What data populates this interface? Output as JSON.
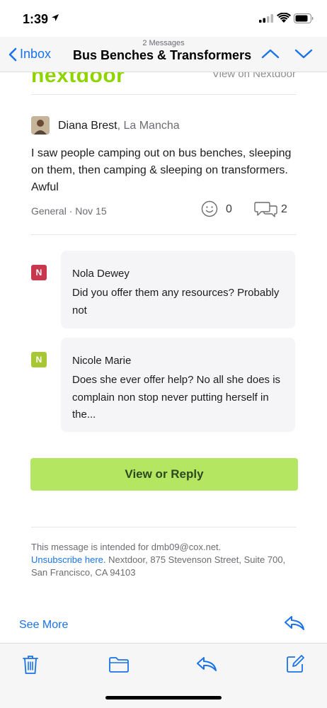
{
  "status_bar": {
    "time": "1:39"
  },
  "nav": {
    "message_count": "2 Messages",
    "back_label": "Inbox",
    "title": "Bus Benches & Transformers"
  },
  "email": {
    "logo_text": "nextdoor",
    "view_on_link": "View on Nextdoor",
    "post": {
      "author": "Diana Brest",
      "neighborhood": ", La Mancha",
      "body": "I saw people camping out on bus benches, sleeping on them, then camping & sleeping on transformers. Awful",
      "meta": "General · Nov 15",
      "reaction_count": "0",
      "reply_count": "2"
    },
    "comments": [
      {
        "initial": "N",
        "name": "Nola Dewey",
        "text": "Did you offer them any resources? Probably not"
      },
      {
        "initial": "N",
        "name": "Nicole Marie",
        "text": "Does she ever offer help? No all she does is complain non stop never putting herself in the..."
      }
    ],
    "cta_label": "View or Reply",
    "footer": {
      "intended_for": "This message is intended for dmb09@cox.net.",
      "unsubscribe": "Unsubscribe here.",
      "address": " Nextdoor, 875 Stevenson Street, Suite 700, San Francisco, CA 94103"
    }
  },
  "see_more_label": "See More",
  "toolbar": {
    "icons": [
      "trash-icon",
      "folder-icon",
      "reply-icon",
      "compose-icon"
    ]
  },
  "colors": {
    "accent_blue": "#1a73e8",
    "nextdoor_green": "#8ed500",
    "cta_green": "#b5e661"
  }
}
